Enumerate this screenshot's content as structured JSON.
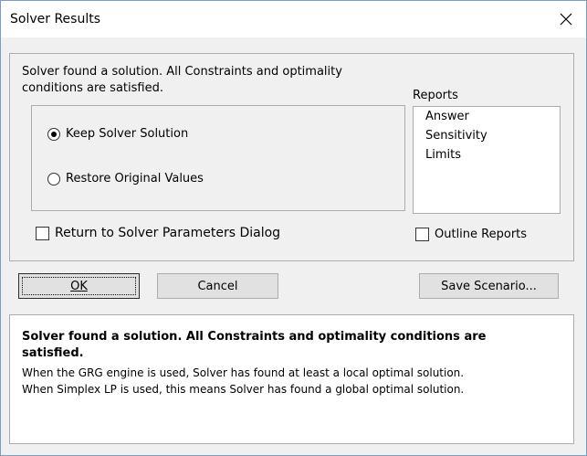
{
  "window": {
    "title": "Solver Results",
    "close_glyph": "✕"
  },
  "message": "Solver found a solution.  All Constraints and optimality conditions are satisfied.",
  "options": {
    "keep": {
      "label": "Keep Solver Solution",
      "selected": true
    },
    "restore": {
      "label": "Restore Original Values",
      "selected": false
    }
  },
  "reports": {
    "label": "Reports",
    "items": [
      "Answer",
      "Sensitivity",
      "Limits"
    ]
  },
  "checkboxes": {
    "return_label": "Return to Solver Parameters Dialog",
    "outline_label": "Outline Reports"
  },
  "buttons": {
    "ok": "OK",
    "cancel": "Cancel",
    "save_scenario": "Save Scenario..."
  },
  "info": {
    "headline": "Solver found a solution.  All Constraints and optimality conditions are satisfied.",
    "line1": "When the GRG engine is used, Solver has found at least a local optimal solution.",
    "line2": "When Simplex LP is used, this means Solver has found a global optimal solution."
  }
}
